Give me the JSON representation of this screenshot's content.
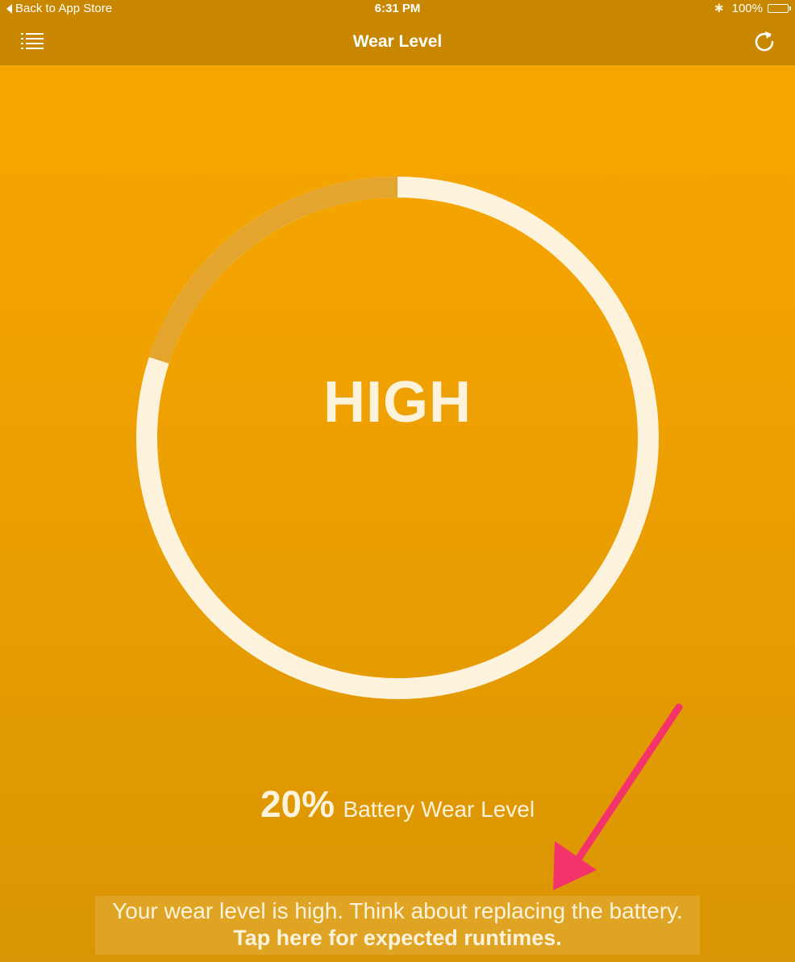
{
  "status_bar": {
    "back_label": "Back to App Store",
    "time": "6:31 PM",
    "battery_percent": "100%"
  },
  "nav": {
    "title": "Wear Level"
  },
  "gauge": {
    "level_label": "HIGH",
    "wear_fraction": 0.2,
    "track_color": "#fdf3dc",
    "wear_color": "#e3a52d"
  },
  "wear": {
    "percent": "20%",
    "label": "Battery Wear Level"
  },
  "message": {
    "line1": "Your wear level is high. Think about replacing the battery.",
    "line2": "Tap here for expected runtimes."
  },
  "colors": {
    "bar": "#c98700",
    "background": "#f2a300",
    "arrow": "#f4336b"
  }
}
